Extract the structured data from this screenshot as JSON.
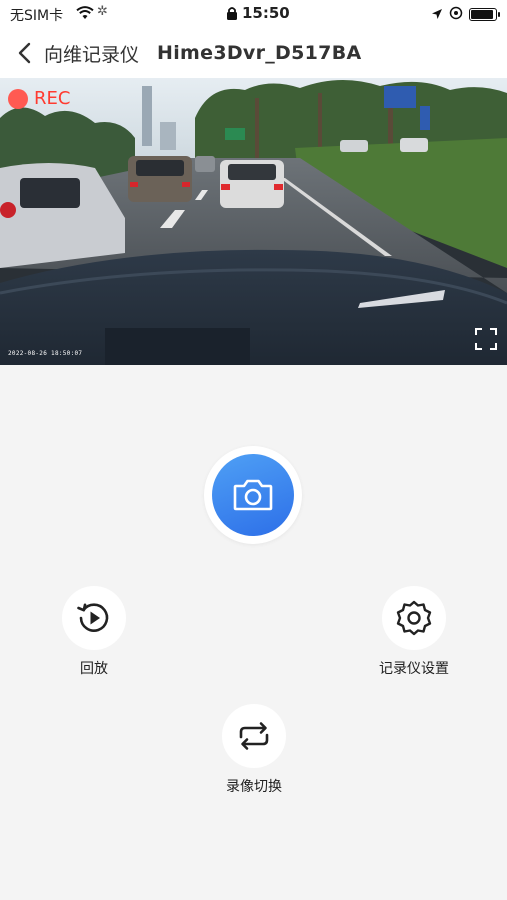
{
  "status_bar": {
    "carrier": "无SIM卡",
    "time": "15:50",
    "battery_level": 0.9
  },
  "nav": {
    "title": "向维记录仪",
    "device_name": "Hime3Dvr_D517BA"
  },
  "video": {
    "rec_label": "REC",
    "osd_timestamp": "2022-08-26   18:50:07"
  },
  "actions": {
    "playback_label": "回放",
    "settings_label": "记录仪设置",
    "switch_label": "录像切换"
  },
  "colors": {
    "accent": "#3480ee",
    "rec": "#ff3b30",
    "background": "#f4f4f4"
  }
}
